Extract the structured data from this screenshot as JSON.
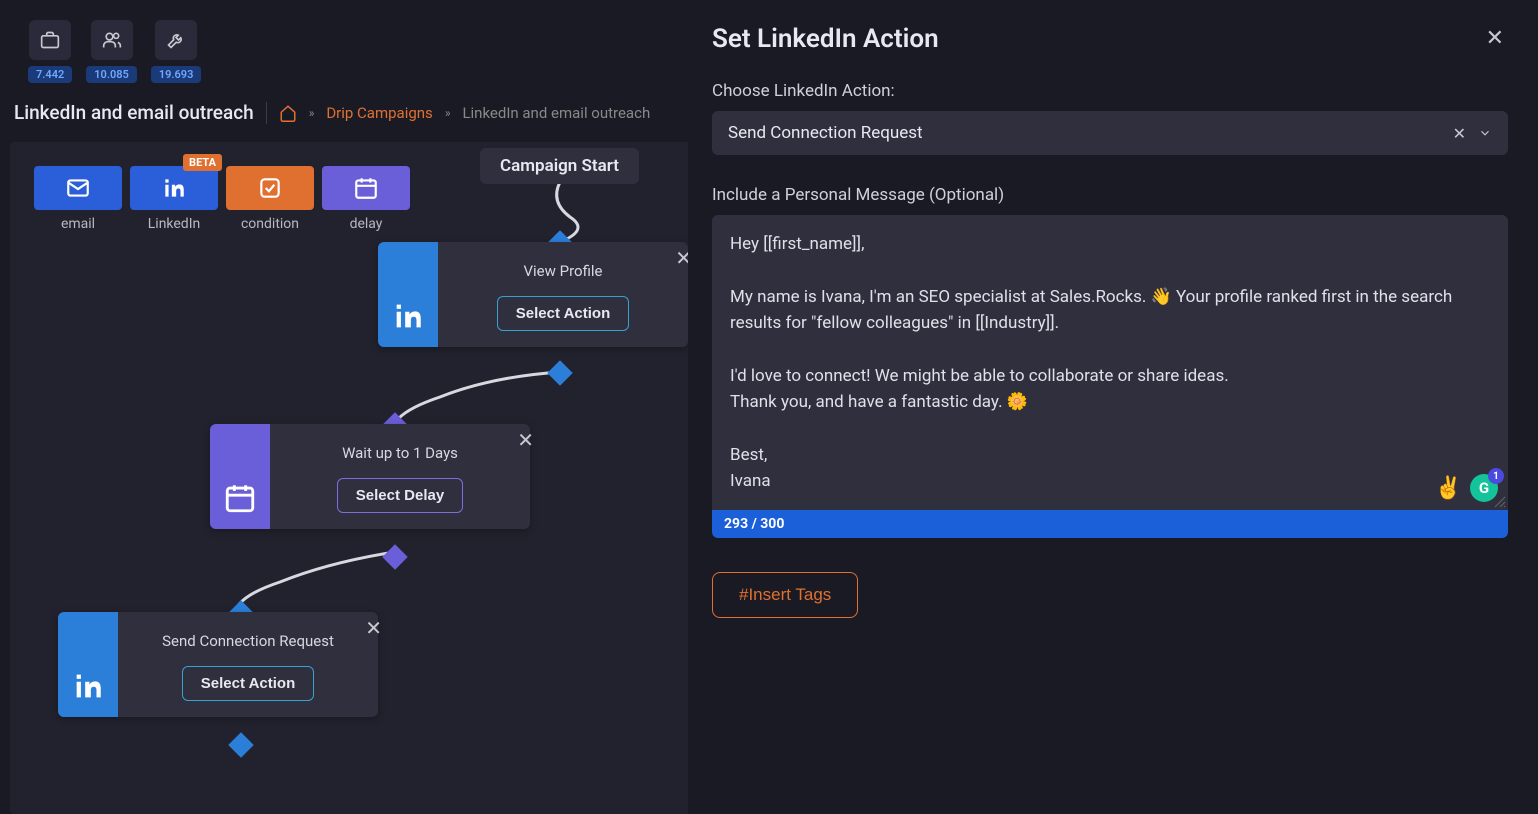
{
  "toolbar": {
    "counts": [
      "7.442",
      "10.085",
      "19.693"
    ]
  },
  "breadcrumb": {
    "title": "LinkedIn and email outreach",
    "link": "Drip Campaigns",
    "current": "LinkedIn and email outreach"
  },
  "palette": {
    "email": "email",
    "linkedin": "LinkedIn",
    "condition": "condition",
    "delay": "delay",
    "beta": "BETA"
  },
  "canvas": {
    "start": "Campaign Start",
    "node1": {
      "title": "View Profile",
      "action": "Select Action"
    },
    "node2": {
      "title": "Wait up to 1 Days",
      "action": "Select Delay"
    },
    "node3": {
      "title": "Send Connection Request",
      "action": "Select Action"
    }
  },
  "panel": {
    "title": "Set LinkedIn Action",
    "choose_label": "Choose LinkedIn Action:",
    "selected_action": "Send Connection Request",
    "message_label": "Include a Personal Message (Optional)",
    "message_body": "Hey [[first_name]],\n\nMy name is Ivana, I'm an SEO specialist at Sales.Rocks. 👋 Your profile ranked first in the search results for \"fellow colleagues\" in [[Industry]].\n\nI'd love to connect! We might be able to collaborate or share ideas.\nThank you, and have a fantastic day. 🌼\n\nBest,\nIvana",
    "char_count": "293 / 300",
    "insert_tags": "#Insert Tags",
    "grammarly_count": "1",
    "emoji": "✌️"
  }
}
